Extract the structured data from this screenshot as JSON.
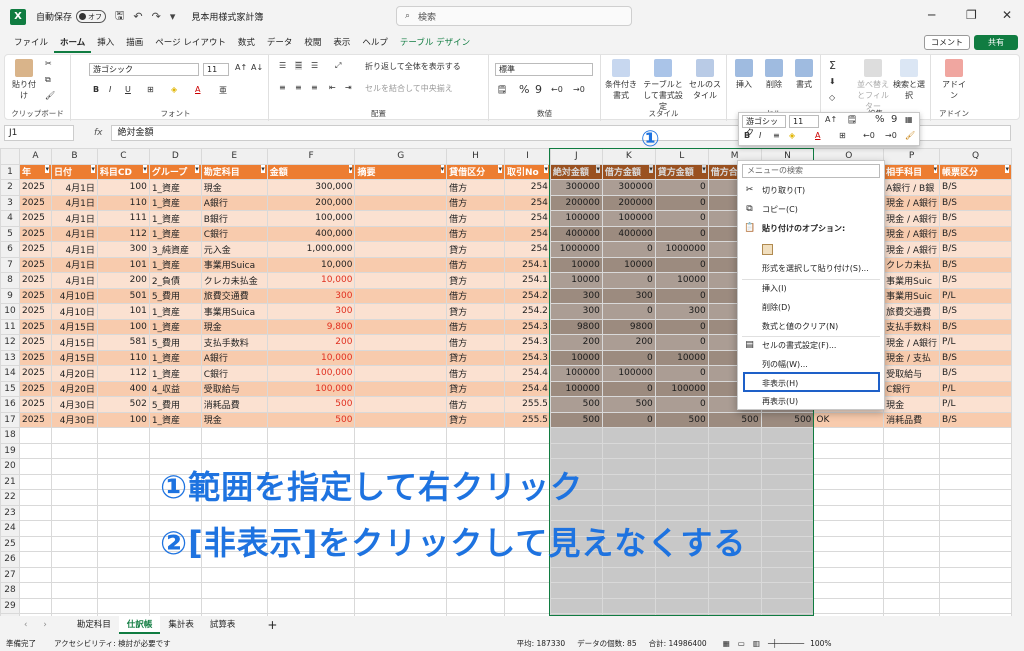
{
  "title": {
    "app_icon": "X",
    "autosave_label": "自動保存",
    "autosave_state": "オフ",
    "document": "見本用様式家計簿",
    "search_placeholder": "検索"
  },
  "menu": [
    "ファイル",
    "ホーム",
    "挿入",
    "描画",
    "ページ レイアウト",
    "数式",
    "データ",
    "校閲",
    "表示",
    "ヘルプ",
    "テーブル デザイン"
  ],
  "actions": {
    "comment": "コメント",
    "share": "共有"
  },
  "ribbon": {
    "clipboard": {
      "label": "クリップボード",
      "paste": "貼り付け"
    },
    "font": {
      "label": "フォント",
      "name": "游ゴシック",
      "size": "11"
    },
    "alignment": {
      "label": "配置",
      "wrap": "折り返して全体を表示する",
      "merge": "セルを結合して中央揃え"
    },
    "number": {
      "label": "数値",
      "format": "標準"
    },
    "styles": {
      "label": "スタイル",
      "cond": "条件付き書式",
      "table": "テーブルとして書式設定",
      "cell": "セルのスタイル"
    },
    "cells": {
      "label": "セル",
      "insert": "挿入",
      "delete": "削除",
      "format": "書式"
    },
    "editing": {
      "label": "編集",
      "sort": "並べ替えとフィルター",
      "find": "検索と選択"
    },
    "addin": {
      "label": "アドイン",
      "btn": "アドイン"
    }
  },
  "formula_bar": {
    "namebox": "J1",
    "fx": "fx",
    "content": "絶対金額"
  },
  "columns": [
    "A",
    "B",
    "C",
    "D",
    "E",
    "F",
    "G",
    "H",
    "I",
    "J",
    "K",
    "L",
    "M",
    "N",
    "O",
    "P",
    "Q"
  ],
  "headers": [
    "年",
    "日付",
    "科目CD",
    "グループ",
    "勘定科目",
    "金額",
    "摘要",
    "貸借区分",
    "取引No",
    "絶対金額",
    "借方金額",
    "貸方金額",
    "借方合",
    "",
    "",
    "相手科目",
    "帳票区分"
  ],
  "rows": [
    [
      "2025",
      "4月1日",
      "100",
      "1_資産",
      "現金",
      "300,000",
      "",
      "借方",
      "254",
      "300000",
      "300000",
      "0",
      "100",
      "",
      "",
      "A銀行 / B銀",
      "B/S"
    ],
    [
      "2025",
      "4月1日",
      "110",
      "1_資産",
      "A銀行",
      "200,000",
      "",
      "借方",
      "254",
      "200000",
      "200000",
      "0",
      "100",
      "",
      "",
      "現金 / A銀行",
      "B/S"
    ],
    [
      "2025",
      "4月1日",
      "111",
      "1_資産",
      "B銀行",
      "100,000",
      "",
      "借方",
      "254",
      "100000",
      "100000",
      "0",
      "100",
      "",
      "",
      "現金 / A銀行",
      "B/S"
    ],
    [
      "2025",
      "4月1日",
      "112",
      "1_資産",
      "C銀行",
      "400,000",
      "",
      "借方",
      "254",
      "400000",
      "400000",
      "0",
      "100",
      "",
      "",
      "現金 / A銀行",
      "B/S"
    ],
    [
      "2025",
      "4月1日",
      "300",
      "3_純資産",
      "元入金",
      "1,000,000",
      "",
      "貸方",
      "254",
      "1000000",
      "0",
      "1000000",
      "100",
      "",
      "",
      "現金 / A銀行",
      "B/S"
    ],
    [
      "2025",
      "4月1日",
      "101",
      "1_資産",
      "事業用Suica",
      "10,000",
      "",
      "借方",
      "254.1",
      "10000",
      "10000",
      "0",
      "",
      "",
      "",
      "クレカ未払",
      "B/S"
    ],
    [
      "2025",
      "4月1日",
      "200",
      "2_負債",
      "クレカ未払金",
      "10,000",
      "",
      "貸方",
      "254.1",
      "10000",
      "0",
      "10000",
      "1",
      "",
      "",
      "事業用Suic",
      "B/S"
    ],
    [
      "2025",
      "4月10日",
      "501",
      "5_費用",
      "旅費交通費",
      "300",
      "",
      "借方",
      "254.2",
      "300",
      "300",
      "0",
      "",
      "",
      "",
      "事業用Suic",
      "P/L"
    ],
    [
      "2025",
      "4月10日",
      "101",
      "1_資産",
      "事業用Suica",
      "300",
      "",
      "貸方",
      "254.2",
      "300",
      "0",
      "300",
      "",
      "",
      "",
      "旅費交通費",
      "B/S"
    ],
    [
      "2025",
      "4月15日",
      "100",
      "1_資産",
      "現金",
      "9,800",
      "",
      "借方",
      "254.3",
      "9800",
      "9800",
      "0",
      "",
      "",
      "",
      "支払手数料",
      "B/S"
    ],
    [
      "2025",
      "4月15日",
      "581",
      "5_費用",
      "支払手数料",
      "200",
      "",
      "借方",
      "254.3",
      "200",
      "200",
      "0",
      "",
      "",
      "",
      "現金 / A銀行",
      "P/L"
    ],
    [
      "2025",
      "4月15日",
      "110",
      "1_資産",
      "A銀行",
      "10,000",
      "",
      "貸方",
      "254.3",
      "10000",
      "0",
      "10000",
      "1",
      "",
      "",
      "現金 / 支払",
      "B/S"
    ],
    [
      "2025",
      "4月20日",
      "112",
      "1_資産",
      "C銀行",
      "100,000",
      "",
      "借方",
      "254.4",
      "100000",
      "100000",
      "0",
      "10",
      "",
      "",
      "受取給与",
      "B/S"
    ],
    [
      "2025",
      "4月20日",
      "400",
      "4_収益",
      "受取給与",
      "100,000",
      "",
      "貸方",
      "254.4",
      "100000",
      "0",
      "100000",
      "10",
      "",
      "",
      "C銀行",
      "P/L"
    ],
    [
      "2025",
      "4月30日",
      "502",
      "5_費用",
      "消耗品費",
      "500",
      "",
      "借方",
      "255.5",
      "500",
      "500",
      "0",
      "",
      "",
      "OK",
      "現金",
      "P/L"
    ],
    [
      "2025",
      "4月30日",
      "100",
      "1_資産",
      "現金",
      "500",
      "",
      "貸方",
      "255.5",
      "500",
      "0",
      "500",
      "500",
      "500",
      "OK",
      "消耗品費",
      "B/S"
    ]
  ],
  "red_rows": [
    6,
    7,
    8,
    9,
    10,
    11,
    12,
    13,
    14,
    15
  ],
  "empty_rows": [
    "18",
    "19",
    "20",
    "21",
    "22",
    "23",
    "24",
    "25",
    "26",
    "27",
    "28",
    "29",
    "30"
  ],
  "annotation": {
    "line1": "①範囲を指定して右クリック",
    "line2": "②[非表示]をクリックして見えなくする",
    "marker1": "①",
    "marker2": "②"
  },
  "mini_toolbar": {
    "font": "游ゴシック",
    "size": "11"
  },
  "context_menu": {
    "search": "メニューの検索",
    "cut": "切り取り(T)",
    "copy": "コピー(C)",
    "paste_opts": "貼り付けのオプション:",
    "paste_special": "形式を選択して貼り付け(S)...",
    "insert": "挿入(I)",
    "delete": "削除(D)",
    "clear": "数式と値のクリア(N)",
    "format": "セルの書式設定(F)...",
    "width": "列の幅(W)...",
    "hide": "非表示(H)",
    "unhide": "再表示(U)"
  },
  "sheets": [
    "勘定科目",
    "仕訳帳",
    "集計表",
    "試算表"
  ],
  "status": {
    "ready": "準備完了",
    "access": "アクセシビリティ: 検討が必要です",
    "avg": "平均: 187330",
    "count": "データの個数: 85",
    "sum": "合計: 14986400",
    "zoom": "100%"
  }
}
